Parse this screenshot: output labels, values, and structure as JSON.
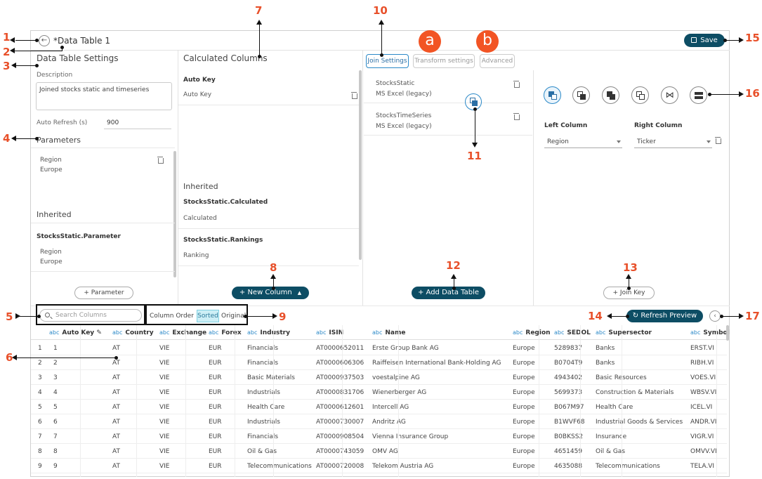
{
  "header": {
    "title": "*Data Table 1",
    "save_label": "Save"
  },
  "settings": {
    "heading": "Data Table Settings",
    "description_label": "Description",
    "description_value": "Joined stocks static and timeseries",
    "auto_refresh_label": "Auto Refresh (s)",
    "auto_refresh_value": "900",
    "parameters_heading": "Parameters",
    "param_name": "Region",
    "param_value": "Europe",
    "inherited_heading": "Inherited",
    "inherited_source": "StocksStatic.Parameter",
    "inherited_param_name": "Region",
    "inherited_param_value": "Europe",
    "add_parameter_label": "Parameter"
  },
  "calculated": {
    "heading": "Calculated Columns",
    "auto_key_title": "Auto Key",
    "auto_key_value": "Auto Key",
    "inherited_heading": "Inherited",
    "inherited_1_title": "StocksStatic.Calculated",
    "inherited_1_value": "Calculated",
    "inherited_2_title": "StocksStatic.Rankings",
    "inherited_2_value": "Ranking",
    "new_column_label": "New Column"
  },
  "tabs": {
    "join": "Join Settings",
    "transform": "Transform settings",
    "advanced": "Advanced"
  },
  "badges": {
    "a": "a",
    "b": "b"
  },
  "sources": [
    {
      "name": "StocksStatic",
      "type": "MS Excel (legacy)"
    },
    {
      "name": "StocksTimeSeries",
      "type": "MS Excel (legacy)"
    }
  ],
  "add_data_table_label": "Add Data Table",
  "join": {
    "left_column_label": "Left Column",
    "right_column_label": "Right Column",
    "left_value": "Region",
    "right_value": "Ticker",
    "join_key_label": "Join Key",
    "icons": [
      "left-join-icon",
      "right-join-icon",
      "inner-join-icon",
      "outer-join-icon",
      "natural-join-icon",
      "union-icon"
    ]
  },
  "toolbar": {
    "search_placeholder": "Search Columns",
    "column_order_label": "Column Order",
    "sorted_label": "Sorted",
    "original_label": "Original",
    "refresh_label": "Refresh Preview"
  },
  "grid": {
    "abc": "abc",
    "columns": [
      "Auto Key",
      "Country",
      "Exchange",
      "Forex",
      "Industry",
      "ISIN",
      "Name",
      "Region",
      "SEDOL",
      "Supersector",
      "Symbol"
    ],
    "rows": [
      [
        "1",
        "1",
        "AT",
        "VIE",
        "EUR",
        "Financials",
        "AT0000652011",
        "Erste Group Bank AG",
        "Europe",
        "5289837",
        "Banks",
        "ERST.VI"
      ],
      [
        "2",
        "2",
        "AT",
        "VIE",
        "EUR",
        "Financials",
        "AT0000606306",
        "Raiffeisen International Bank-Holding AG",
        "Europe",
        "B0704T9",
        "Banks",
        "RIBH.VI"
      ],
      [
        "3",
        "3",
        "AT",
        "VIE",
        "EUR",
        "Basic Materials",
        "AT0000937503",
        "voestalpine AG",
        "Europe",
        "4943402",
        "Basic Resources",
        "VOES.VI"
      ],
      [
        "4",
        "4",
        "AT",
        "VIE",
        "EUR",
        "Industrials",
        "AT0000831706",
        "Wienerberger AG",
        "Europe",
        "5699373",
        "Construction & Materials",
        "WBSV.VI"
      ],
      [
        "5",
        "5",
        "AT",
        "VIE",
        "EUR",
        "Health Care",
        "AT0000612601",
        "Intercell AG",
        "Europe",
        "B067M97",
        "Health Care",
        "ICEL.VI"
      ],
      [
        "6",
        "6",
        "AT",
        "VIE",
        "EUR",
        "Industrials",
        "AT0000730007",
        "Andritz AG",
        "Europe",
        "B1WVF68",
        "Industrial Goods & Services",
        "ANDR.VI"
      ],
      [
        "7",
        "7",
        "AT",
        "VIE",
        "EUR",
        "Financials",
        "AT0000908504",
        "Vienna Insurance Group",
        "Europe",
        "B0BKSS2",
        "Insurance",
        "VIGR.VI"
      ],
      [
        "8",
        "8",
        "AT",
        "VIE",
        "EUR",
        "Oil & Gas",
        "AT0000743059",
        "OMV AG",
        "Europe",
        "4651459",
        "Oil & Gas",
        "OMVV.VI"
      ],
      [
        "9",
        "9",
        "AT",
        "VIE",
        "EUR",
        "Telecommunications",
        "AT0000720008",
        "Telekom Austria AG",
        "Europe",
        "4635088",
        "Telecommunications",
        "TELA.VI"
      ]
    ]
  },
  "callouts": [
    "1",
    "2",
    "3",
    "4",
    "5",
    "6",
    "7",
    "8",
    "9",
    "10",
    "11",
    "12",
    "13",
    "14",
    "15",
    "16",
    "17"
  ]
}
